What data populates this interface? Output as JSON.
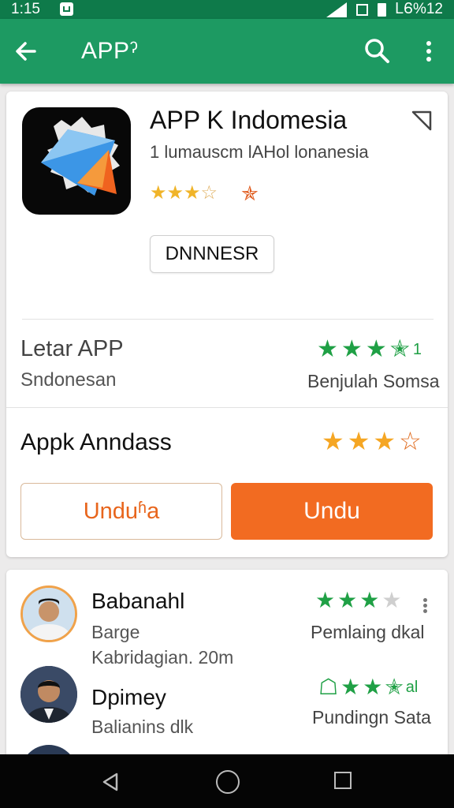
{
  "status_bar": {
    "time": "1:15",
    "right_text": "ᏞᏮ%12"
  },
  "app_bar": {
    "title": "APPˀ",
    "back_icon": "arrow-left-icon",
    "search_icon": "search-icon",
    "more_icon": "more-vert-icon"
  },
  "app": {
    "name": "APP K Indomesia",
    "developer": "1 lumausсm lAHol lonanesia",
    "rating_stars": 3,
    "install_label": "DNNNESR"
  },
  "section1": {
    "title": "Letar APP",
    "subtitle": "Sndonesan",
    "stars": 3.5,
    "note": "Benjulah Somsa",
    "stars_suffix": "1"
  },
  "section2": {
    "title": "Appk Anndass",
    "stars": 3,
    "button_outline": "Unduʱa",
    "button_filled": "Undu"
  },
  "reviews": [
    {
      "name": "Babanahl",
      "line1": "Barge",
      "line2": "Kabridagian. 20m",
      "stars": 3.5,
      "note": "Pemlaing dkal"
    },
    {
      "name": "Dpimey",
      "line1": "Balianins dlk",
      "line2": "",
      "stars": 3.5,
      "note": "Pundingn Sata",
      "stars_suffix": "al"
    }
  ],
  "colors": {
    "status_bar": "#0e7a4a",
    "app_bar": "#1d9a62",
    "accent_orange": "#f26b21",
    "star_green": "#1fa045",
    "star_gold": "#f5a623"
  }
}
